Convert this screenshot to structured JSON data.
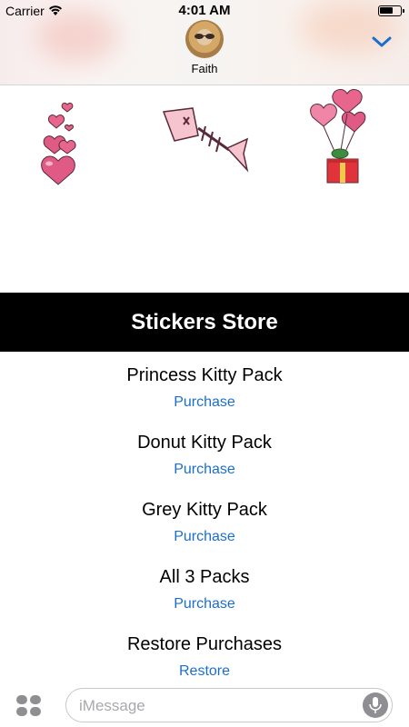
{
  "status_bar": {
    "carrier": "Carrier",
    "time": "4:01 AM",
    "battery_level": 0.65
  },
  "header": {
    "contact_name": "Faith",
    "collapse_icon": "chevron-down-icon",
    "accent_color": "#1a6fce"
  },
  "stickers": [
    {
      "icon": "pink-hearts-sticker"
    },
    {
      "icon": "fish-bone-sticker"
    },
    {
      "icon": "heart-balloons-gift-sticker"
    }
  ],
  "store": {
    "title": "Stickers Store",
    "packs": [
      {
        "name": "Princess Kitty Pack",
        "action": "Purchase"
      },
      {
        "name": "Donut Kitty Pack",
        "action": "Purchase"
      },
      {
        "name": "Grey Kitty Pack",
        "action": "Purchase"
      },
      {
        "name": "All 3 Packs",
        "action": "Purchase"
      },
      {
        "name": "Restore Purchases",
        "action": "Restore"
      }
    ]
  },
  "input_bar": {
    "placeholder": "iMessage",
    "apps_icon": "app-drawer-icon",
    "mic_icon": "microphone-icon"
  }
}
